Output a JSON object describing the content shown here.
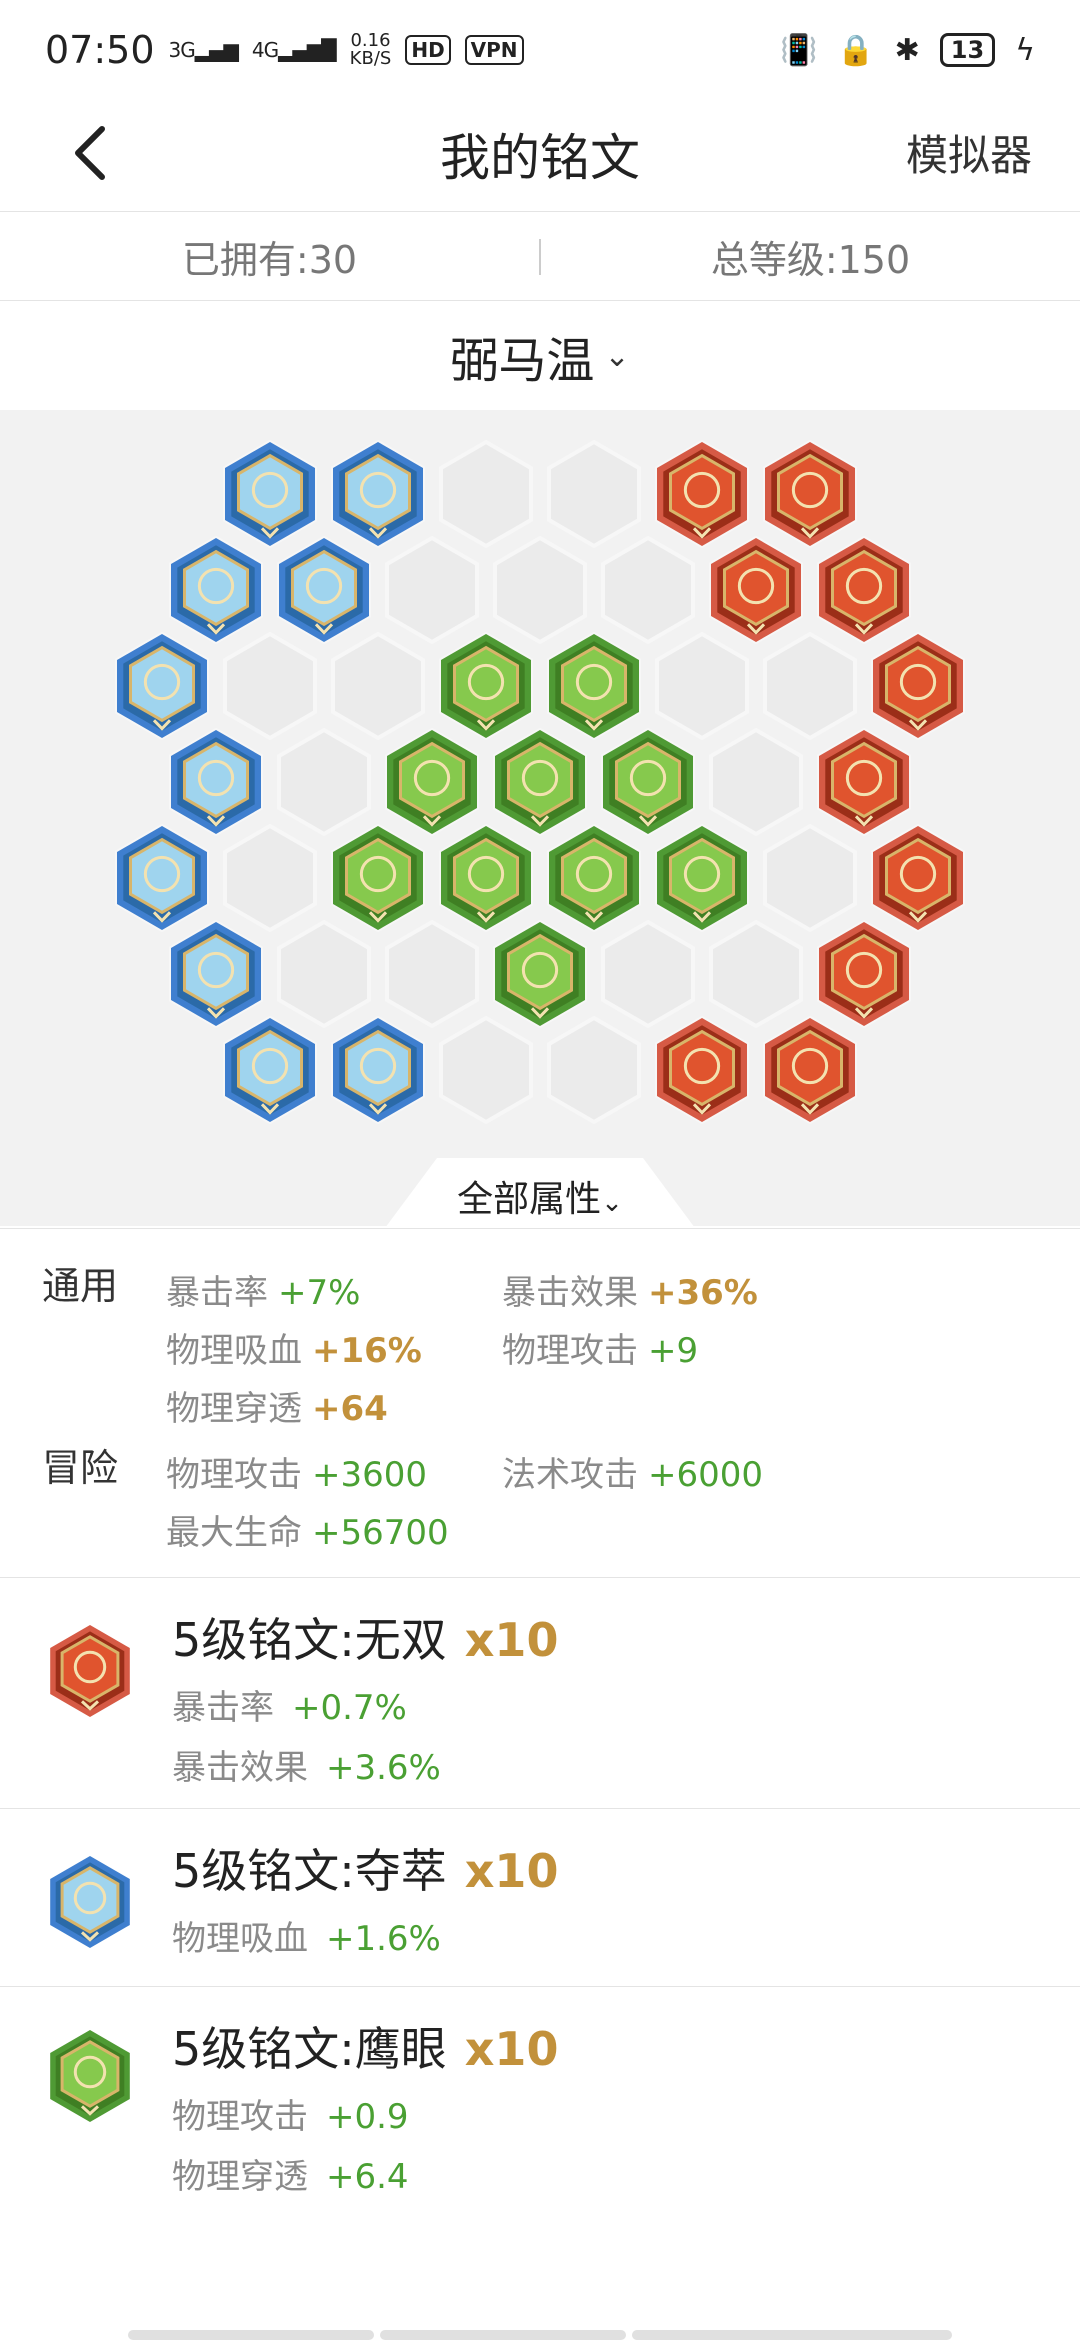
{
  "status_bar": {
    "time": "07:50",
    "net1": "3G",
    "net2": "4G",
    "speed": "0.16",
    "speed_unit": "KB/S",
    "hd": "HD",
    "vpn": "VPN",
    "battery": "13",
    "icons": [
      "vibrate-icon",
      "lock-rotation-icon",
      "bluetooth-icon",
      "battery-icon",
      "charging-icon"
    ]
  },
  "header": {
    "title": "我的铭文",
    "simulator": "模拟器"
  },
  "counts": {
    "owned": "已拥有:30",
    "total_level": "总等级:150"
  },
  "page_selector": {
    "name": "弼马温"
  },
  "board": {
    "colors": {
      "blue": "#3f7fcf",
      "red": "#d65a45",
      "green": "#4f9a34",
      "empty": "#ebebeb"
    },
    "all_attributes_label": "全部属性"
  },
  "attributes": {
    "general_label": "通用",
    "general": [
      {
        "name": "暴击率",
        "value": "+7%"
      },
      {
        "name": "暴击效果",
        "value": "+36%"
      },
      {
        "name": "物理吸血",
        "value": "+16%"
      },
      {
        "name": "物理攻击",
        "value": "+9"
      },
      {
        "name": "物理穿透",
        "value": "+64"
      }
    ],
    "adventure_label": "冒险",
    "adventure": [
      {
        "name": "物理攻击",
        "value": "+3600"
      },
      {
        "name": "法术攻击",
        "value": "+6000"
      },
      {
        "name": "最大生命",
        "value": "+56700"
      }
    ]
  },
  "inscriptions": [
    {
      "name": "5级铭文:无双",
      "count": "x10",
      "color": "red",
      "stats": [
        {
          "name": "暴击率",
          "value": "+0.7%"
        },
        {
          "name": "暴击效果",
          "value": "+3.6%"
        }
      ]
    },
    {
      "name": "5级铭文:夺萃",
      "count": "x10",
      "color": "blue",
      "stats": [
        {
          "name": "物理吸血",
          "value": "+1.6%"
        }
      ]
    },
    {
      "name": "5级铭文:鹰眼",
      "count": "x10",
      "color": "green",
      "stats": [
        {
          "name": "物理攻击",
          "value": "+0.9"
        },
        {
          "name": "物理穿透",
          "value": "+6.4"
        }
      ]
    }
  ]
}
